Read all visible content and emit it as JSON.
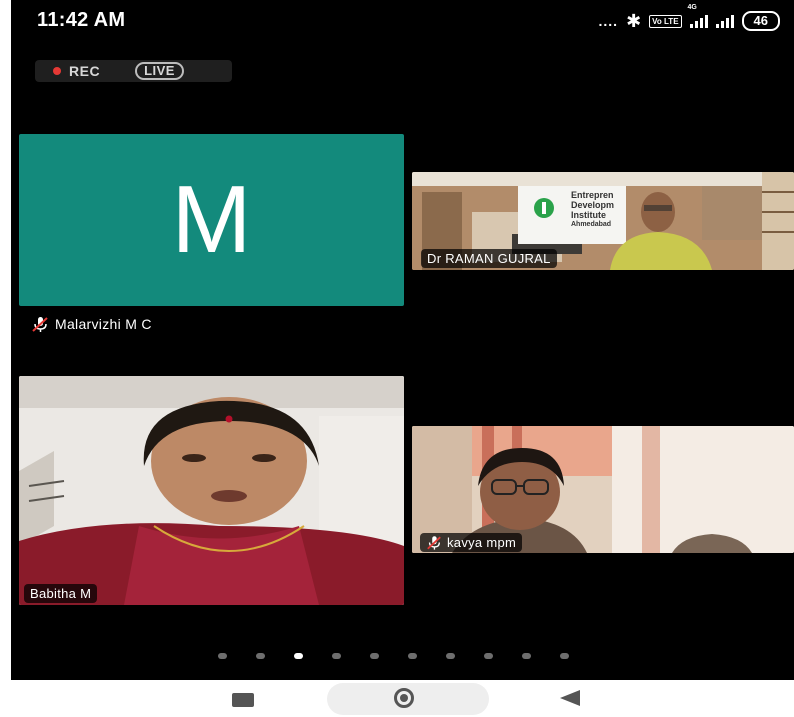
{
  "status_bar": {
    "time": "11:42 AM",
    "signal_dots": "....",
    "volte": "Vo LTE",
    "network": "4G",
    "battery": "46"
  },
  "recording": {
    "rec_label": "REC",
    "live_label": "LIVE",
    "rec_color": "#e53935"
  },
  "participants": [
    {
      "name": "Malarvizhi M C",
      "avatar_letter": "M",
      "avatar_color": "#138a7c",
      "muted": true,
      "video": false
    },
    {
      "name": "Dr RAMAN GUJRAL",
      "muted": false,
      "video": true,
      "background_sign": [
        "Entrepren",
        "Developm",
        "Institute",
        "Ahmedabad"
      ]
    },
    {
      "name": "Babitha M",
      "muted": false,
      "video": true
    },
    {
      "name": "kavya mpm",
      "muted": true,
      "video": true
    }
  ],
  "pager": {
    "count": 10,
    "active_index": 2
  },
  "icons": {
    "mic_muted": "mic-off-icon",
    "bluetooth": "bluetooth-icon",
    "home": "home-circle-icon",
    "back": "back-triangle-icon",
    "recent": "recent-apps-icon"
  }
}
